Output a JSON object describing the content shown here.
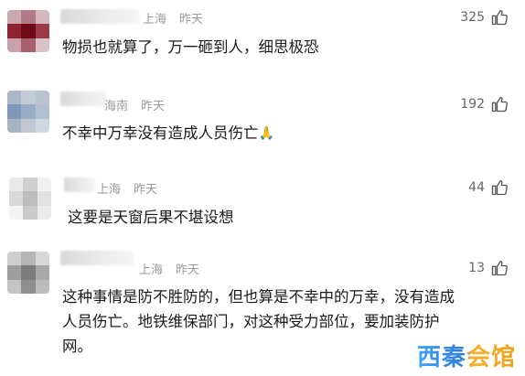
{
  "comments": [
    {
      "location": "上海",
      "time": "昨天",
      "likes": "325",
      "text_lines": [
        "物损也就算了，万一砸到人，细思极恐"
      ],
      "avatar_colors": [
        "#c9a9b0",
        "#b07a86",
        "#d4b8be",
        "#8e2430",
        "#6e0b16",
        "#9a3c48",
        "#c7a2aa",
        "#a8616c",
        "#d9c3c8"
      ]
    },
    {
      "location": "海南",
      "time": "昨天",
      "likes": "192",
      "text_lines": [
        "不幸中万幸没有造成人员伤亡"
      ],
      "emoji": "🙏",
      "avatar_colors": [
        "#aab7c8",
        "#c4ccd6",
        "#b9c3cf",
        "#7f98ba",
        "#9aadc6",
        "#b2bfcf",
        "#a7b4c3",
        "#bfc8d3",
        "#d0d7df"
      ]
    },
    {
      "location": "上海",
      "time": "昨天",
      "likes": "44",
      "text_lines": [
        "这要是天窗后果不堪设想"
      ],
      "avatar_colors": [
        "#e9e9e9",
        "#cfcfcf",
        "#f1f1f1",
        "#d9d9d9",
        "#bdbdbd",
        "#e2e2e2",
        "#f3f3f3",
        "#cacaca",
        "#ebebeb"
      ]
    },
    {
      "location": "上海",
      "time": "昨天",
      "likes": "13",
      "text_lines": [
        "这种事情是防不胜防的，但也算是不幸中的万幸，没有造成",
        "人员伤亡。地铁维保部门，对这种受力部位，要加装防护",
        "网。"
      ],
      "avatar_colors": [
        "#cfcfcf",
        "#b5b5b5",
        "#d8d8d8",
        "#9e9e9e",
        "#7c7c7c",
        "#a9a9a9",
        "#c4c4c4",
        "#8f8f8f",
        "#bcbcbc"
      ]
    }
  ],
  "watermark": "西秦会馆",
  "icons": {
    "like": "thumbs-up-icon",
    "emoji": "praying-hands-emoji"
  }
}
